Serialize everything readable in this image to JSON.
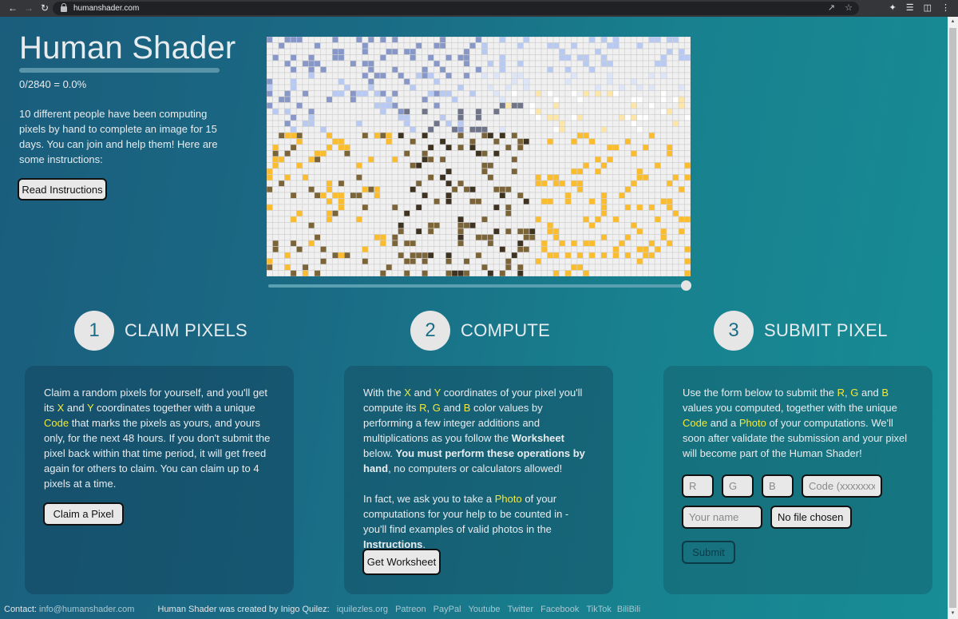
{
  "browser": {
    "url": "humanshader.com",
    "nav_icons": [
      "back-arrow",
      "forward-arrow",
      "reload"
    ],
    "omnibox_icons": [
      "share",
      "bookmark-star"
    ],
    "toolbar_icons": [
      "extensions-puzzle",
      "media-queue",
      "side-panel",
      "menu-kebab"
    ]
  },
  "header": {
    "title": "Human Shader",
    "progress": {
      "done": 0,
      "total": 2840,
      "fraction": 0.0,
      "text": "0/2840 = 0.0%"
    },
    "intro": "10 different people have been computing pixels by hand to complete an image for 15 days. You can join and help them! Here are some instructions:",
    "read_instructions_label": "Read Instructions"
  },
  "canvas": {
    "columns": 71,
    "rows": 40,
    "background": "#f0f0f0",
    "palette": {
      "sky_dark": "#8798c8",
      "sky_light": "#b8caf2",
      "sky_pale": "#dde6f8",
      "white": "#ffffff",
      "gold": "#fbbd2e",
      "pale_gold": "#fde6a8",
      "brown": "#7a6438",
      "dark_brown": "#3e3220",
      "gray": "#6f7488"
    },
    "slider_value": 1.0
  },
  "steps": [
    {
      "number": "1",
      "title": "CLAIM PIXELS",
      "text": [
        {
          "t": "Claim a random pixels for yourself, and you'll get its "
        },
        {
          "t": "X",
          "hl": true
        },
        {
          "t": " and "
        },
        {
          "t": "Y",
          "hl": true
        },
        {
          "t": " coordinates together with a unique "
        },
        {
          "t": "Code",
          "hl": true
        },
        {
          "t": " that marks the pixels as yours, and yours only, for the next 48 hours. If you don't submit the pixel back within that time period, it will get freed again for others to claim. You can claim up to 4 pixels at a time."
        }
      ],
      "button_label": "Claim a Pixel"
    },
    {
      "number": "2",
      "title": "COMPUTE",
      "text": [
        {
          "t": "With the "
        },
        {
          "t": "X",
          "hl": true
        },
        {
          "t": " and "
        },
        {
          "t": "Y",
          "hl": true
        },
        {
          "t": " coordinates of your pixel you'll compute its "
        },
        {
          "t": "R",
          "hl": true
        },
        {
          "t": ", "
        },
        {
          "t": "G",
          "hl": true
        },
        {
          "t": " and "
        },
        {
          "t": "B",
          "hl": true
        },
        {
          "t": " color values by performing a few integer additions and multiplications as you follow the "
        },
        {
          "t": "Worksheet",
          "b": true
        },
        {
          "t": " below. "
        },
        {
          "t": "You must perform these operations by hand",
          "b": true
        },
        {
          "t": ", no computers or calculators allowed!"
        }
      ],
      "text2": [
        {
          "t": "In fact, we ask you to take a "
        },
        {
          "t": "Photo",
          "hl": true
        },
        {
          "t": " of your computations for your help to be counted in - you'll find examples of valid photos in the "
        },
        {
          "t": "Instructions",
          "b": true
        },
        {
          "t": "."
        }
      ],
      "button_label": "Get Worksheet"
    },
    {
      "number": "3",
      "title": "SUBMIT PIXEL",
      "text": [
        {
          "t": "Use the form below to submit the "
        },
        {
          "t": "R",
          "hl": true
        },
        {
          "t": ", "
        },
        {
          "t": "G",
          "hl": true
        },
        {
          "t": " and "
        },
        {
          "t": "B",
          "hl": true
        },
        {
          "t": " values you computed, together with the unique "
        },
        {
          "t": "Code",
          "hl": true
        },
        {
          "t": " and a "
        },
        {
          "t": "Photo",
          "hl": true
        },
        {
          "t": " of your computations. We'll soon after validate the submission and your pixel will become part of the Human Shader!"
        }
      ],
      "form": {
        "r_placeholder": "R",
        "r_value": "",
        "g_placeholder": "G",
        "g_value": "",
        "b_placeholder": "B",
        "b_value": "",
        "code_placeholder": "Code (xxxxxxxx)",
        "code_value": "",
        "name_placeholder": "Your name",
        "name_value": "",
        "file_label": "No file chosen",
        "submit_label": "Submit"
      }
    }
  ],
  "footer": {
    "contact_label": "Contact:",
    "contact_email": "info@humanshader.com",
    "credit": "Human Shader was created by Inigo Quilez:",
    "links": [
      "iquilezles.org",
      "Patreon",
      "PayPal",
      "Youtube",
      "Twitter",
      "Facebook",
      "TikTok",
      "BiliBili"
    ]
  },
  "colors": {
    "highlight": "#f3e83a",
    "page_gradient_start": "#1a5d7c",
    "page_gradient_end": "#178d95",
    "link": "#a5c8d4"
  }
}
